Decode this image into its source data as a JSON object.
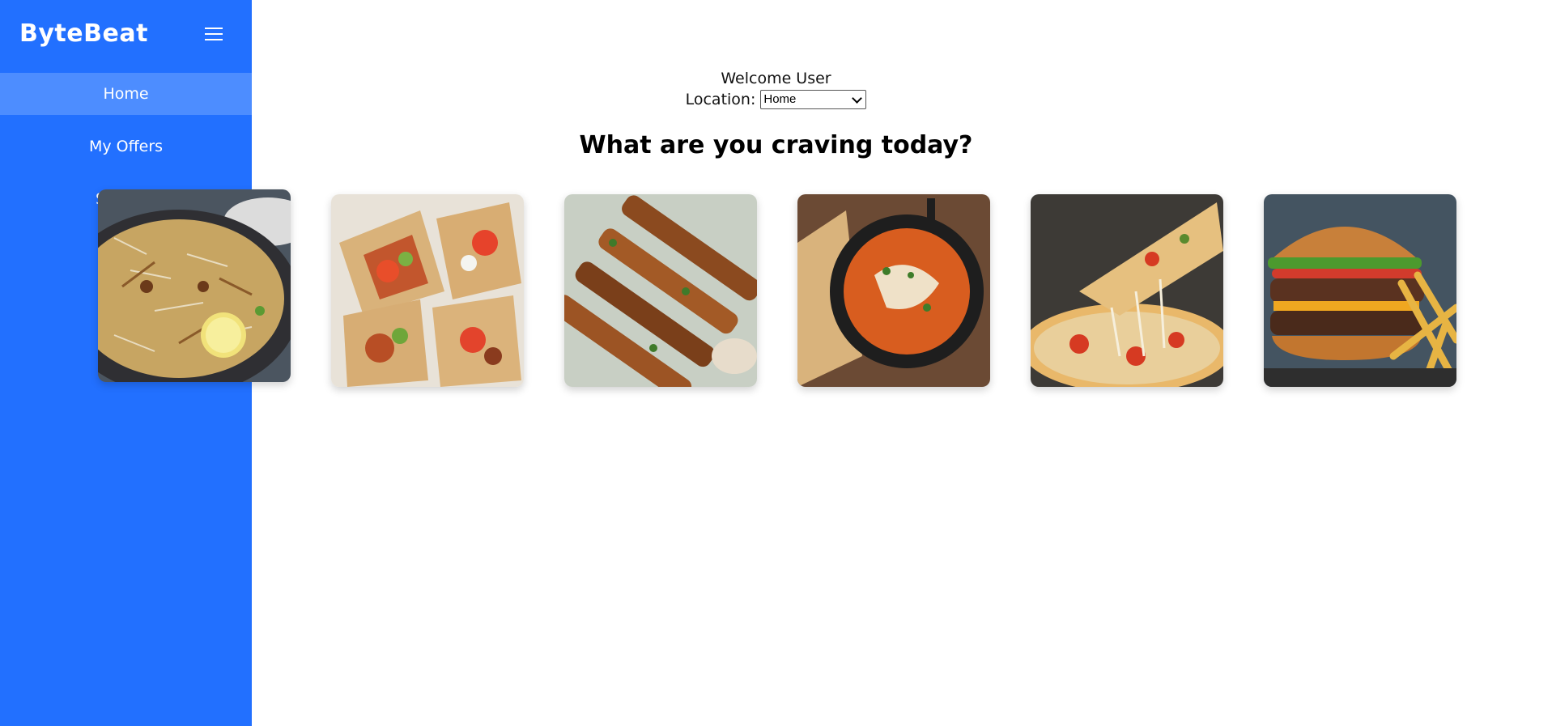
{
  "app": {
    "brand": "ByteBeat",
    "menu_icon": "hamburger-icon"
  },
  "sidebar": {
    "items": [
      {
        "label": "Home",
        "active": true
      },
      {
        "label": "My Offers",
        "active": false
      },
      {
        "label": "Support",
        "active": false
      }
    ]
  },
  "header": {
    "welcome": "Welcome User",
    "location_label": "Location:",
    "location_value": "Home"
  },
  "main": {
    "title": "What are you craving today?",
    "food_items": [
      {
        "name": "biryani"
      },
      {
        "name": "shawarma-wraps"
      },
      {
        "name": "chicken-skewers"
      },
      {
        "name": "butter-chicken"
      },
      {
        "name": "pizza"
      },
      {
        "name": "burger"
      }
    ]
  },
  "colors": {
    "sidebar_bg": "#2270ff",
    "sidebar_active": "#4d8dff",
    "text": "#000000",
    "background": "#ffffff"
  }
}
